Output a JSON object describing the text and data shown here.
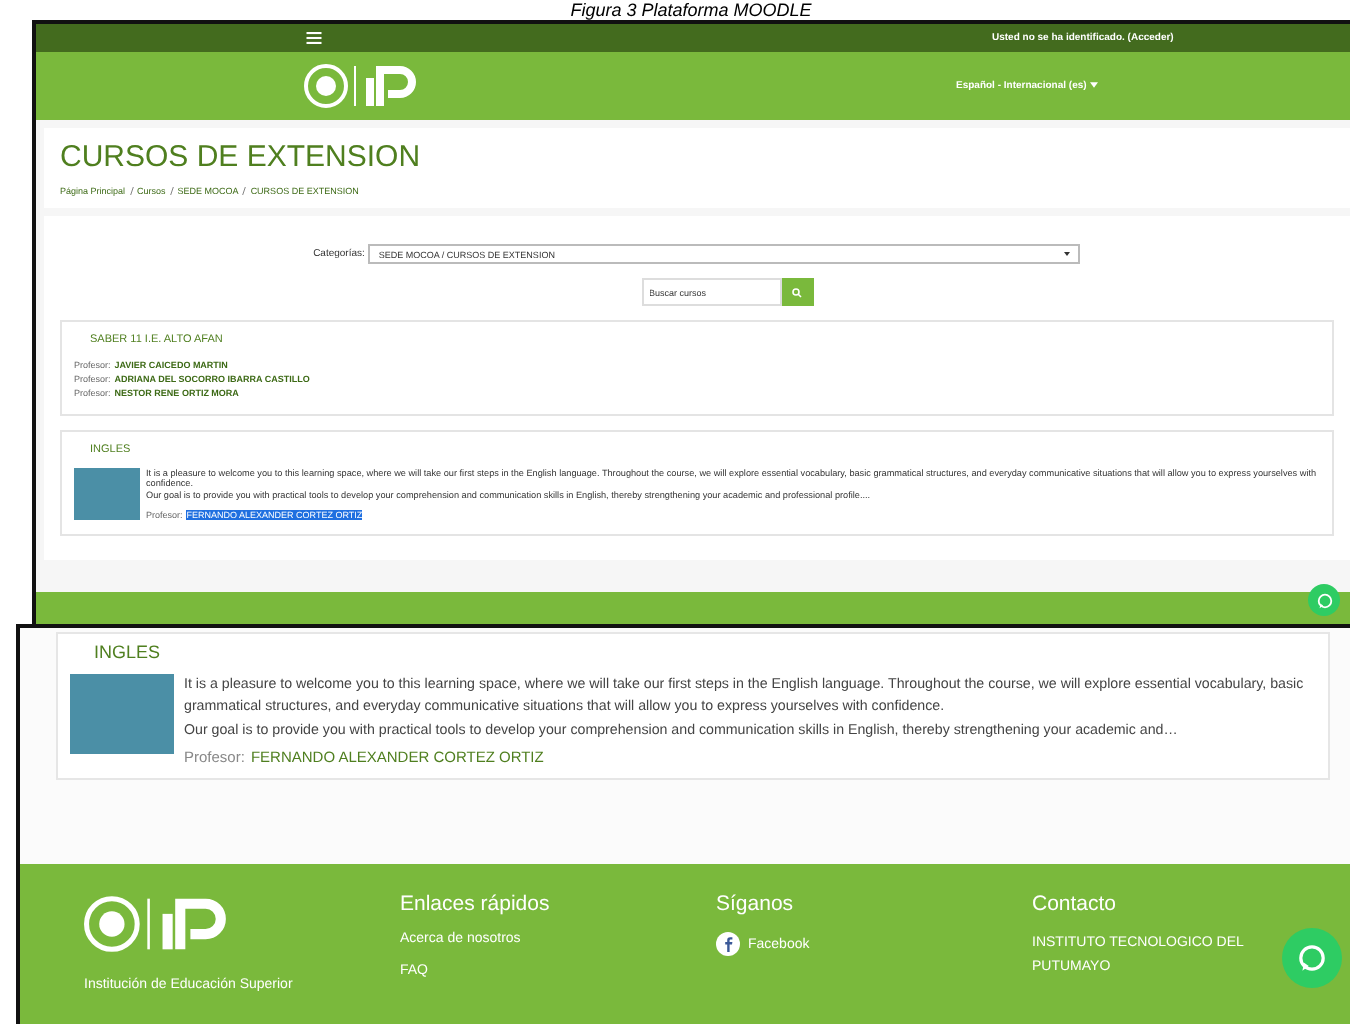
{
  "caption": "Figura 3 Plataforma MOODLE",
  "moodle_page": {
    "login_text": "Usted no se ha identificado. (Acceder)",
    "language": "Español - Internacional (es)",
    "title": "CURSOS DE EXTENSION",
    "breadcrumb": [
      "Página Principal",
      "Cursos",
      "SEDE MOCOA",
      "CURSOS DE EXTENSION"
    ],
    "category_label": "Categorías:",
    "category_value": "SEDE MOCOA / CURSOS DE EXTENSION",
    "search": {
      "placeholder": "Buscar cursos"
    },
    "courses": [
      {
        "name": "SABER 11 I.E. ALTO AFAN",
        "kind": "plain",
        "teachers": [
          {
            "label": "Profesor:",
            "name": "JAVIER CAICEDO MARTIN",
            "selected": false
          },
          {
            "label": "Profesor:",
            "name": "ADRIANA DEL SOCORRO IBARRA CASTILLO",
            "selected": false
          },
          {
            "label": "Profesor:",
            "name": "NESTOR RENE ORTIZ MORA",
            "selected": false
          }
        ]
      },
      {
        "name": "INGLES",
        "kind": "image",
        "summary": [
          "It is a pleasure to welcome you to this learning space, where we will take our first steps in the English language. Throughout the course, we will explore essential vocabulary, basic grammatical structures, and everyday communicative situations that will allow you to express yourselves with confidence.",
          "Our goal is to provide you with practical tools to develop your comprehension and communication skills in English, thereby strengthening your academic and professional profile...."
        ],
        "teachers": [
          {
            "label": "Profesor:",
            "name": "FERNANDO ALEXANDER CORTEZ ORTIZ",
            "selected": true
          }
        ]
      }
    ]
  },
  "zoomed_view": {
    "course": {
      "name": "INGLES",
      "summary": [
        "It is a pleasure to welcome you to this learning space, where we will take our first steps in the English language. Throughout the course, we will explore essential vocabulary, basic grammatical structures, and everyday communicative situations that will allow you to express yourselves with confidence.",
        "Our goal is to provide you with practical tools to develop your comprehension and communication skills in English, thereby strengthening your academic and…"
      ],
      "teacher_label": "Profesor:",
      "teacher": "FERNANDO ALEXANDER CORTEZ ORTIZ"
    },
    "footer": {
      "tagline": "Institución de Educación Superior",
      "columns": [
        {
          "kind": "links",
          "heading": "Enlaces rápidos",
          "items": [
            "Acerca de nosotros",
            "FAQ"
          ]
        },
        {
          "kind": "social",
          "heading": "Síganos",
          "items": [
            "Facebook"
          ]
        },
        {
          "kind": "text",
          "heading": "Contacto",
          "items": [
            "INSTITUTO TECNOLOGICO DEL PUTUMAYO"
          ]
        }
      ]
    }
  }
}
